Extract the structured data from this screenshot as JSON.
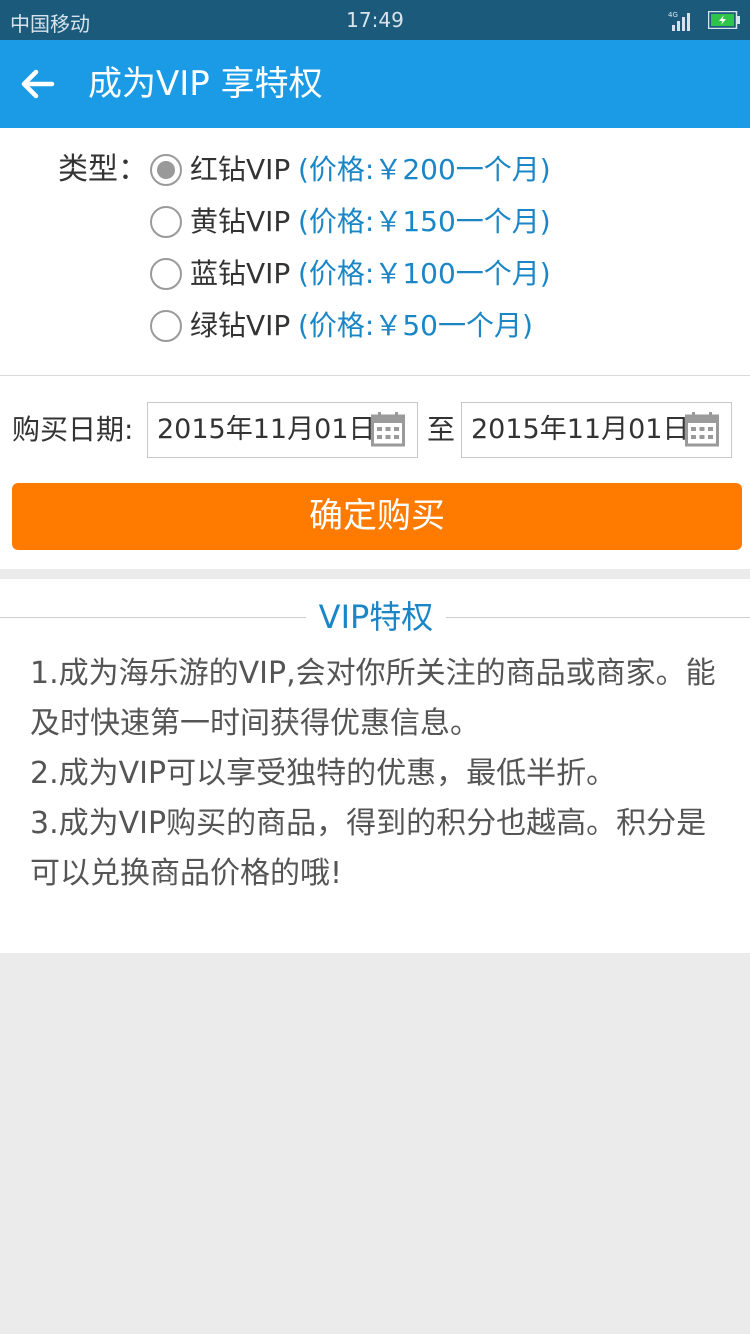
{
  "status_bar": {
    "carrier": "中国移动",
    "time": "17:49",
    "network": "4G"
  },
  "header": {
    "title": "成为VIP 享特权"
  },
  "type_section": {
    "label": "类型：",
    "options": [
      {
        "name": "红钻VIP",
        "price": "(价格:￥200一个月)",
        "checked": true
      },
      {
        "name": "黄钻VIP",
        "price": "(价格:￥150一个月)",
        "checked": false
      },
      {
        "name": "蓝钻VIP",
        "price": "(价格:￥100一个月)",
        "checked": false
      },
      {
        "name": "绿钻VIP",
        "price": "(价格:￥50一个月)",
        "checked": false
      }
    ]
  },
  "purchase": {
    "date_label": "购买日期:",
    "start_date": "2015年11月01日",
    "separator": "至",
    "end_date": "2015年11月01日",
    "button_label": "确定购买"
  },
  "privileges": {
    "title": "VIP特权",
    "lines": [
      "1.成为海乐游的VIP,会对你所关注的商品或商家。能及时快速第一时间获得优惠信息。",
      "2.成为VIP可以享受独特的优惠，最低半折。",
      "3.成为VIP购买的商品，得到的积分也越高。积分是可以兑换商品价格的哦!"
    ]
  },
  "colors": {
    "status_bar": "#1c5a7c",
    "title_bar": "#1b9be6",
    "accent_button": "#ff7b00",
    "link_blue": "#1b86c6",
    "background": "#ebebeb"
  },
  "icons": {
    "back": "arrow-left-icon",
    "calendar": "calendar-icon",
    "signal": "signal-icon",
    "battery": "battery-charging-icon"
  }
}
